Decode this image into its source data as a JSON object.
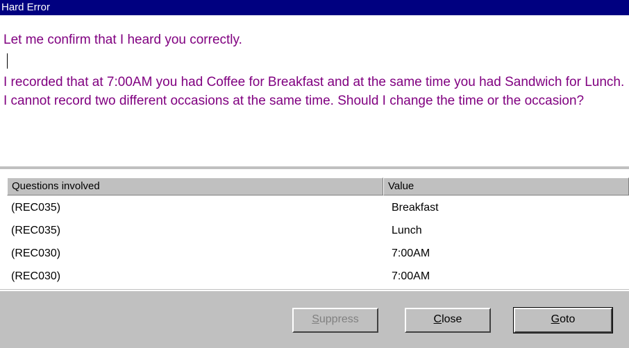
{
  "window": {
    "title": "Hard Error",
    "title_bar_color": "#000080"
  },
  "message": {
    "confirm": "Let me confirm that I heard you correctly.",
    "body": "I recorded that at 7:00AM you had Coffee for Breakfast and at the same time you had Sandwich for Lunch. I cannot record two different occasions at the same time. Should I change the time or the occasion?",
    "text_color": "#800080"
  },
  "grid": {
    "columns": [
      "Questions involved",
      "Value"
    ],
    "rows": [
      {
        "question": "(REC035)",
        "value": "Breakfast"
      },
      {
        "question": "(REC035)",
        "value": "Lunch"
      },
      {
        "question": "(REC030)",
        "value": "7:00AM"
      },
      {
        "question": "(REC030)",
        "value": "7:00AM"
      }
    ]
  },
  "buttons": {
    "suppress": {
      "accel": "S",
      "rest": "uppress",
      "enabled": false
    },
    "close": {
      "accel": "C",
      "rest": "lose",
      "enabled": true
    },
    "goto": {
      "accel": "G",
      "rest": "oto",
      "enabled": true
    }
  }
}
